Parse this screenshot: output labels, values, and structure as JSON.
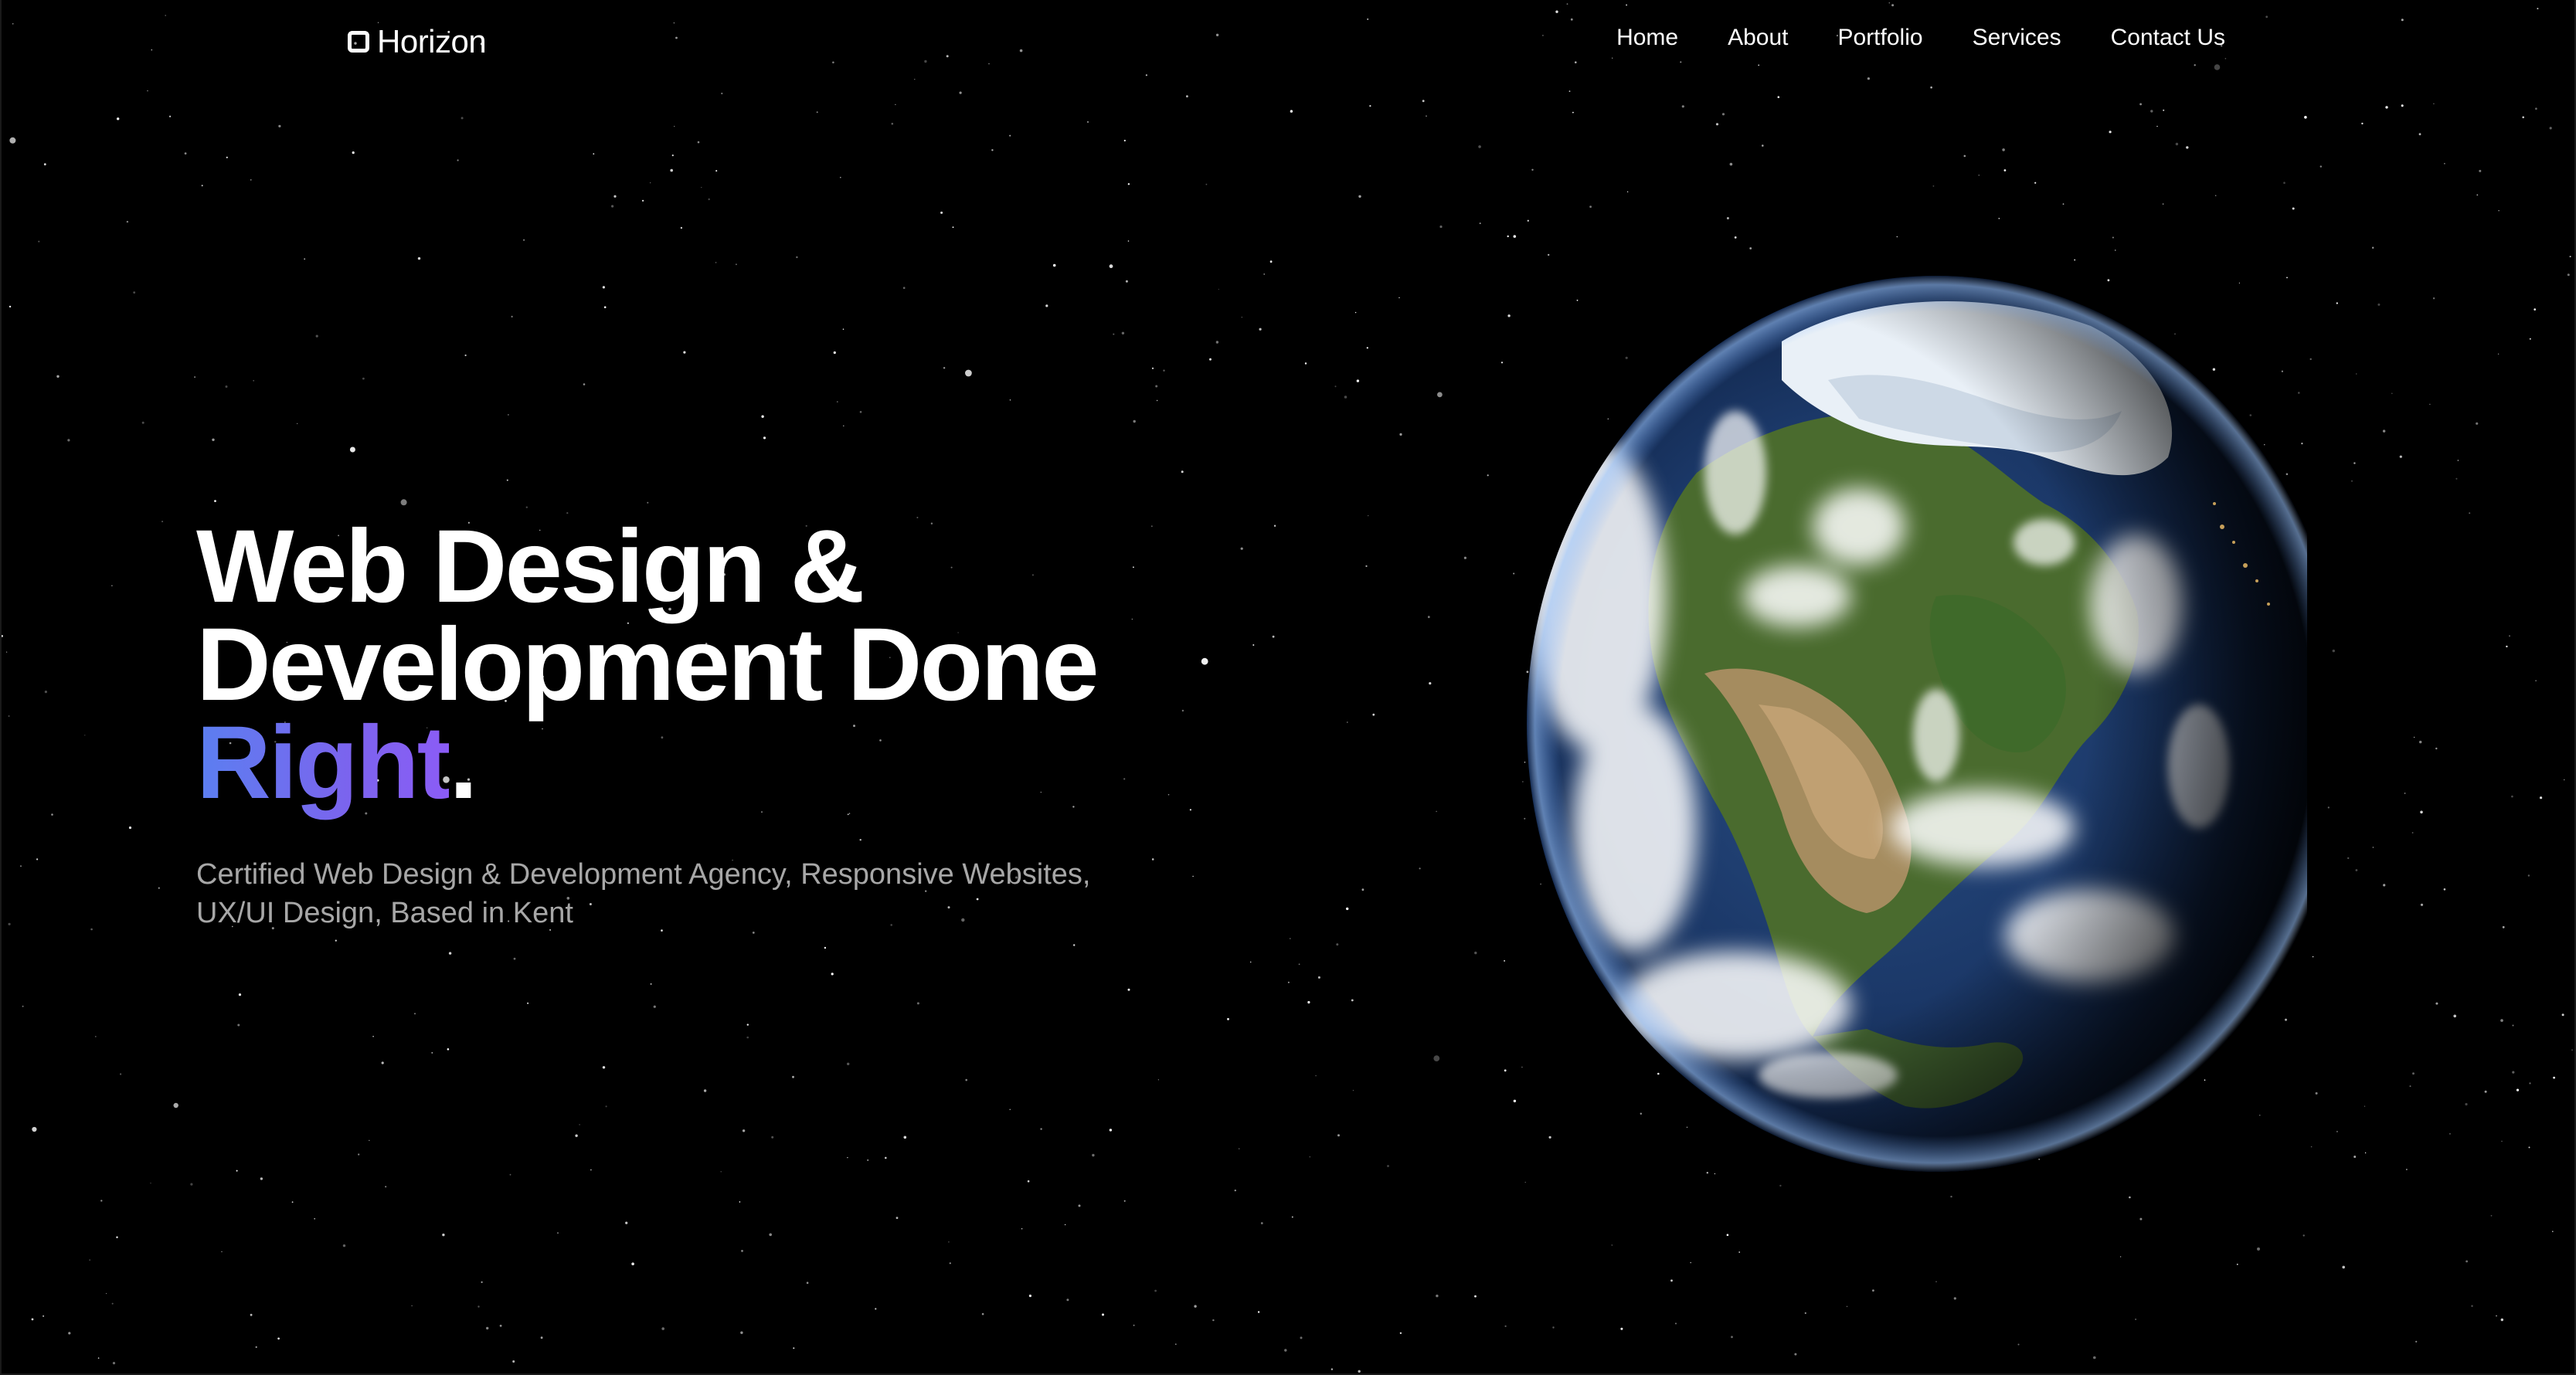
{
  "brand": {
    "name": "Horizon",
    "logo_icon": "rounded-square-icon"
  },
  "nav": {
    "items": [
      {
        "label": "Home"
      },
      {
        "label": "About"
      },
      {
        "label": "Portfolio"
      },
      {
        "label": "Services"
      },
      {
        "label": "Contact Us"
      }
    ]
  },
  "hero": {
    "headline_line1": "Web Design &",
    "headline_line2": "Development Done",
    "headline_accent": "Right",
    "headline_period": ".",
    "subtitle_line1": "Certified Web Design & Development Agency, Responsive Websites,",
    "subtitle_line2": "UX/UI Design, Based in Kent"
  },
  "colors": {
    "background": "#000000",
    "text": "#ffffff",
    "subtitle": "#a7a7a7",
    "accent_gradient_start": "#5b7ff0",
    "accent_gradient_end": "#8b5cf6"
  }
}
